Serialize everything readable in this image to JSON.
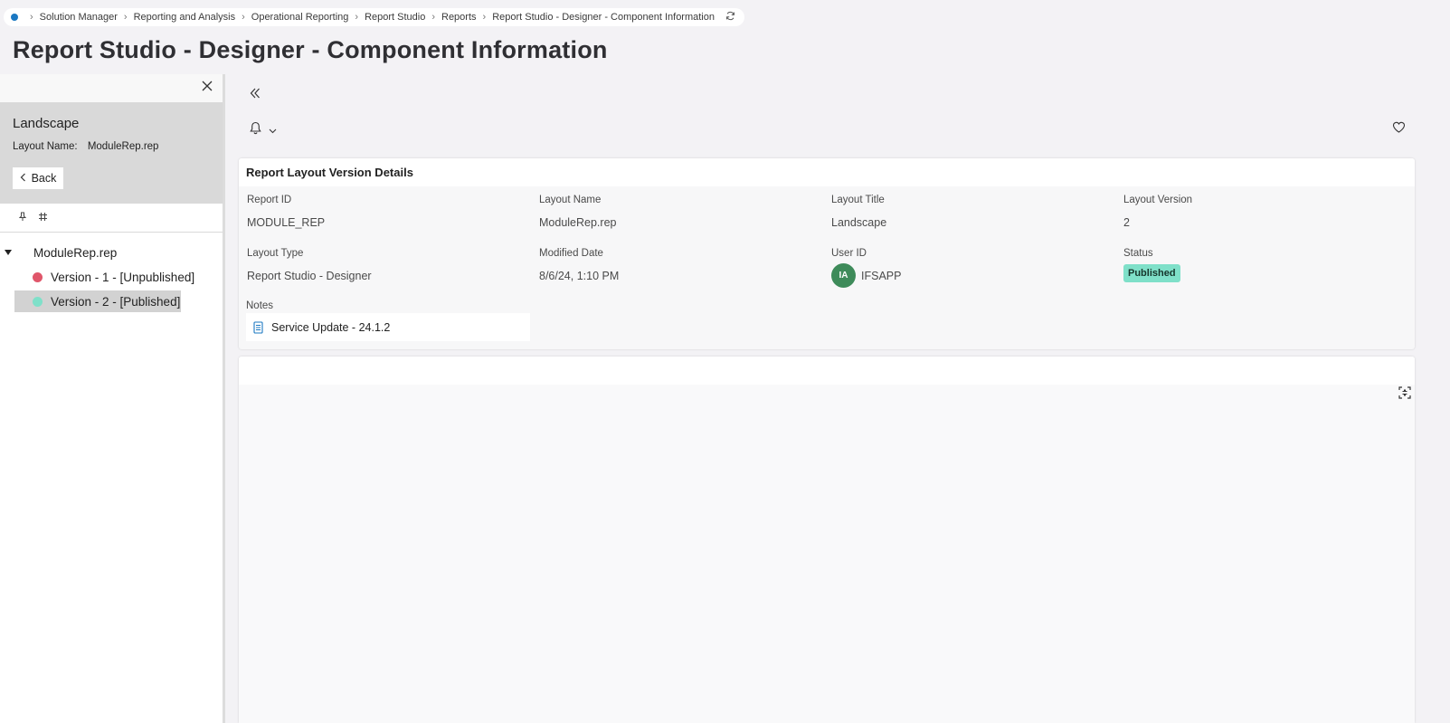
{
  "breadcrumb": {
    "items": [
      "Solution Manager",
      "Reporting and Analysis",
      "Operational Reporting",
      "Report Studio",
      "Reports"
    ],
    "current": "Report Studio - Designer - Component Information"
  },
  "page": {
    "title": "Report Studio - Designer - Component Information"
  },
  "left_panel": {
    "title": "Landscape",
    "layout_name_label": "Layout Name:",
    "layout_name_value": "ModuleRep.rep",
    "back_label": "Back",
    "tree": {
      "root": "ModuleRep.rep",
      "items": [
        {
          "label": "Version - 1 - [Unpublished]",
          "color": "#e0566a"
        },
        {
          "label": "Version - 2 - [Published]",
          "color": "#7fe0c9"
        }
      ]
    }
  },
  "details": {
    "title": "Report Layout Version Details",
    "report_id": {
      "label": "Report ID",
      "value": "MODULE_REP"
    },
    "layout_name": {
      "label": "Layout Name",
      "value": "ModuleRep.rep"
    },
    "layout_title": {
      "label": "Layout Title",
      "value": "Landscape"
    },
    "layout_version": {
      "label": "Layout Version",
      "value": "2"
    },
    "layout_type": {
      "label": "Layout Type",
      "value": "Report Studio - Designer"
    },
    "modified_date": {
      "label": "Modified Date",
      "value": "8/6/24, 1:10 PM"
    },
    "user_id": {
      "label": "User ID",
      "initials": "IA",
      "value": "IFSAPP"
    },
    "status": {
      "label": "Status",
      "value": "Published",
      "color": "#7fe0c9"
    },
    "notes": {
      "label": "Notes",
      "value": "Service Update - 24.1.2"
    }
  },
  "icons": {
    "home": "home-dot-icon",
    "refresh": "refresh-icon",
    "close": "close-icon",
    "pin": "pin-icon",
    "grid": "hash-icon",
    "collapse": "double-chevron-left-icon",
    "bell": "bell-icon",
    "favorite": "heart-icon",
    "expand": "expand-icon",
    "note": "document-icon"
  }
}
